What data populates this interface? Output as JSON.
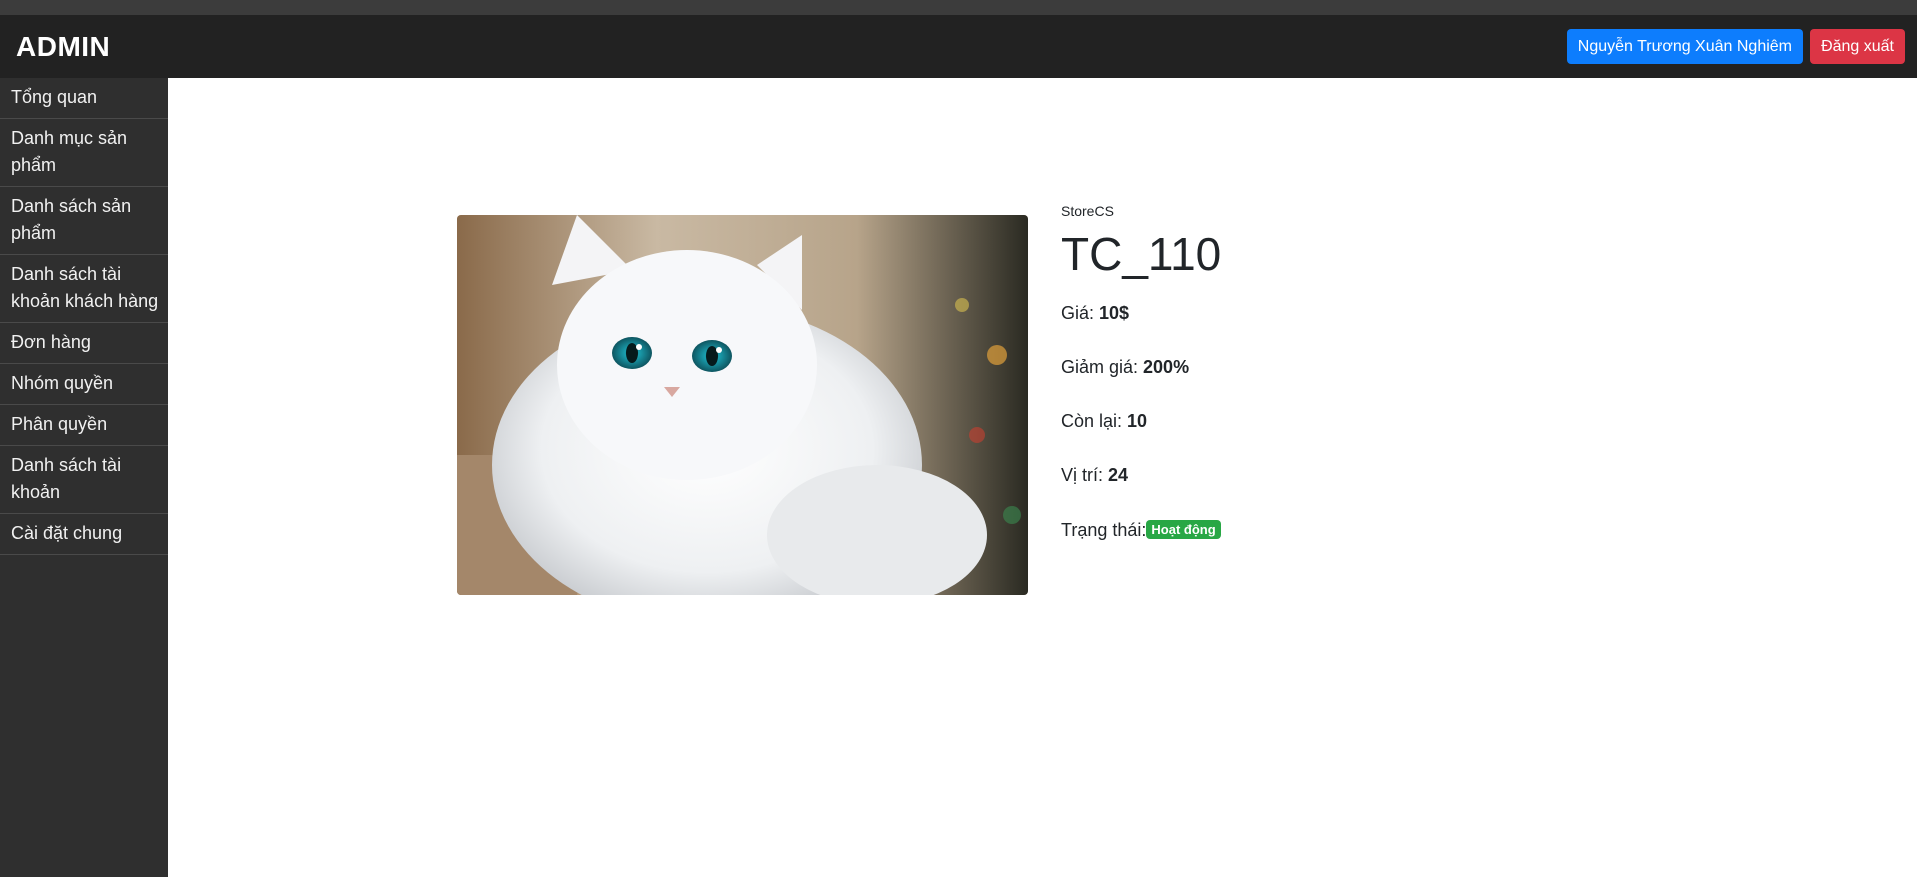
{
  "header": {
    "brand": "ADMIN",
    "user_button": "Nguyễn Trương Xuân Nghiêm",
    "logout_button": "Đăng xuất"
  },
  "sidebar": {
    "items": [
      {
        "label": "Tổng quan"
      },
      {
        "label": "Danh mục sản phẩm"
      },
      {
        "label": "Danh sách sản phẩm"
      },
      {
        "label": "Danh sách tài khoản khách hàng"
      },
      {
        "label": "Đơn hàng"
      },
      {
        "label": "Nhóm quyền"
      },
      {
        "label": "Phân quyền"
      },
      {
        "label": "Danh sách tài khoản"
      },
      {
        "label": "Cài đặt chung"
      }
    ]
  },
  "product": {
    "store": "StoreCS",
    "title": "TC_110",
    "price_label": "Giá: ",
    "price_value": "10$",
    "discount_label": "Giảm giá: ",
    "discount_value": "200%",
    "stock_label": "Còn lại: ",
    "stock_value": "10",
    "position_label": "Vị trí: ",
    "position_value": "24",
    "status_label": "Trạng thái:",
    "status_value": "Hoạt động"
  },
  "colors": {
    "user_button": "#0d7dfd",
    "logout_button": "#dc3545",
    "status_badge": "#28a745"
  }
}
